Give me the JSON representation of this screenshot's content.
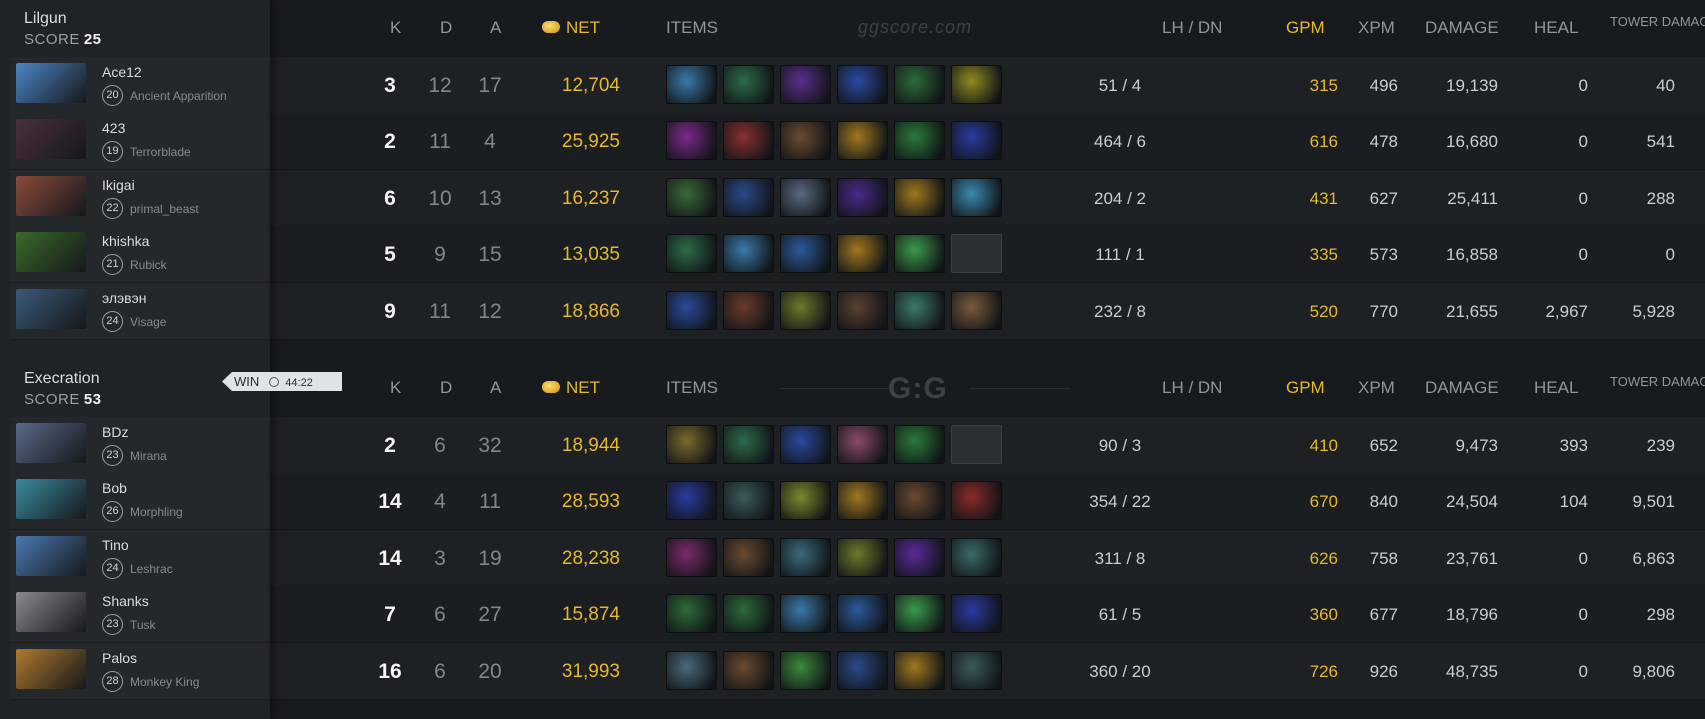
{
  "header": {
    "k": "K",
    "d": "D",
    "a": "A",
    "net": "NET",
    "items": "ITEMS",
    "lh_dn": "LH  /  DN",
    "gpm": "GPM",
    "xpm": "XPM",
    "damage": "DAMAGE",
    "heal": "HEAL",
    "tower_damage": "TOWER DAMAGE"
  },
  "watermark": {
    "top": "ggscore.com",
    "bottom": "G:G"
  },
  "win_tag": {
    "label": "WIN",
    "time": "44:22"
  },
  "teams": [
    {
      "name": "Lilgun",
      "score_label": "SCORE",
      "score": "25",
      "players": [
        {
          "name": "Ace12",
          "level": "20",
          "hero": "Ancient Apparition",
          "k": "3",
          "d": "12",
          "a": "17",
          "net": "12,704",
          "lh_dn": "51  /  4",
          "gpm": "315",
          "xpm": "496",
          "damage": "19,139",
          "heal": "0",
          "tower": "40",
          "portrait_color": "#4d86c8",
          "items": [
            "#3a7aa8",
            "#2c6b4a",
            "#5a2f8a",
            "#2a4aa0",
            "#2d6b3a",
            "#8f8a20"
          ]
        },
        {
          "name": "423",
          "level": "19",
          "hero": "Terrorblade",
          "k": "2",
          "d": "11",
          "a": "4",
          "net": "25,925",
          "lh_dn": "464  /  6",
          "gpm": "616",
          "xpm": "478",
          "damage": "16,680",
          "heal": "0",
          "tower": "541",
          "portrait_color": "#4a3040",
          "items": [
            "#7a2a8a",
            "#8a3030",
            "#6a4a30",
            "#a07820",
            "#2a7a3a",
            "#2a3aa0"
          ]
        },
        {
          "name": "Ikigai",
          "level": "22",
          "hero": "primal_beast",
          "k": "6",
          "d": "10",
          "a": "13",
          "net": "16,237",
          "lh_dn": "204  /  2",
          "gpm": "431",
          "xpm": "627",
          "damage": "25,411",
          "heal": "0",
          "tower": "288",
          "portrait_color": "#8a4a3a",
          "items": [
            "#3a6a3a",
            "#2a4a8a",
            "#5a6a80",
            "#4a2a8a",
            "#a07820",
            "#3a8ab0"
          ]
        },
        {
          "name": "khishka",
          "level": "21",
          "hero": "Rubick",
          "k": "5",
          "d": "9",
          "a": "15",
          "net": "13,035",
          "lh_dn": "111  /  1",
          "gpm": "335",
          "xpm": "573",
          "damage": "16,858",
          "heal": "0",
          "tower": "0",
          "portrait_color": "#3a6a2a",
          "items": [
            "#2c6b4a",
            "#3a7aa8",
            "#2a5a9a",
            "#a07820",
            "#3a9a4a",
            "empty"
          ]
        },
        {
          "name": "элэвэн",
          "level": "24",
          "hero": "Visage",
          "k": "9",
          "d": "11",
          "a": "12",
          "net": "18,866",
          "lh_dn": "232  /  8",
          "gpm": "520",
          "xpm": "770",
          "damage": "21,655",
          "heal": "2,967",
          "tower": "5,928",
          "portrait_color": "#3a5a7a",
          "items": [
            "#2a4a9a",
            "#6a3a2a",
            "#6a7a2a",
            "#5a4030",
            "#3a7a6a",
            "#7a5a3a"
          ]
        }
      ]
    },
    {
      "name": "Execration",
      "score_label": "SCORE",
      "score": "53",
      "players": [
        {
          "name": "BDz",
          "level": "23",
          "hero": "Mirana",
          "k": "2",
          "d": "6",
          "a": "32",
          "net": "18,944",
          "lh_dn": "90  /  3",
          "gpm": "410",
          "xpm": "652",
          "damage": "9,473",
          "heal": "393",
          "tower": "239",
          "portrait_color": "#5a6a8a",
          "items": [
            "#7a6a2a",
            "#2c6b4a",
            "#2a4aa0",
            "#8a4a6a",
            "#2a7a3a",
            "empty"
          ]
        },
        {
          "name": "Bob",
          "level": "26",
          "hero": "Morphling",
          "k": "14",
          "d": "4",
          "a": "11",
          "net": "28,593",
          "lh_dn": "354  /  22",
          "gpm": "670",
          "xpm": "840",
          "damage": "24,504",
          "heal": "104",
          "tower": "9,501",
          "portrait_color": "#3a8aa0",
          "items": [
            "#2a3aa0",
            "#3a5a5a",
            "#7a8a2a",
            "#a07820",
            "#6a4a30",
            "#8a2a2a"
          ]
        },
        {
          "name": "Tino",
          "level": "24",
          "hero": "Leshrac",
          "k": "14",
          "d": "3",
          "a": "19",
          "net": "28,238",
          "lh_dn": "311  /  8",
          "gpm": "626",
          "xpm": "758",
          "damage": "23,761",
          "heal": "0",
          "tower": "6,863",
          "portrait_color": "#4a7ab0",
          "items": [
            "#7a2a6a",
            "#6a4a30",
            "#3a6a7a",
            "#6a7a2a",
            "#5a2a9a",
            "#3a6a6a"
          ]
        },
        {
          "name": "Shanks",
          "level": "23",
          "hero": "Tusk",
          "k": "7",
          "d": "6",
          "a": "27",
          "net": "15,874",
          "lh_dn": "61  /  5",
          "gpm": "360",
          "xpm": "677",
          "damage": "18,796",
          "heal": "0",
          "tower": "298",
          "portrait_color": "#8a8a90",
          "items": [
            "#2d6b3a",
            "#2a6a3a",
            "#3a7aa8",
            "#2a5a9a",
            "#3a9a4a",
            "#2a3aa0"
          ]
        },
        {
          "name": "Palos",
          "level": "28",
          "hero": "Monkey King",
          "k": "16",
          "d": "6",
          "a": "20",
          "net": "31,993",
          "lh_dn": "360  /  20",
          "gpm": "726",
          "xpm": "926",
          "damage": "48,735",
          "heal": "0",
          "tower": "9,806",
          "portrait_color": "#b07a30",
          "items": [
            "#4a6a7a",
            "#6a4a30",
            "#3a8a3a",
            "#2a4a8a",
            "#a07820",
            "#3a5a5a"
          ]
        }
      ]
    }
  ]
}
